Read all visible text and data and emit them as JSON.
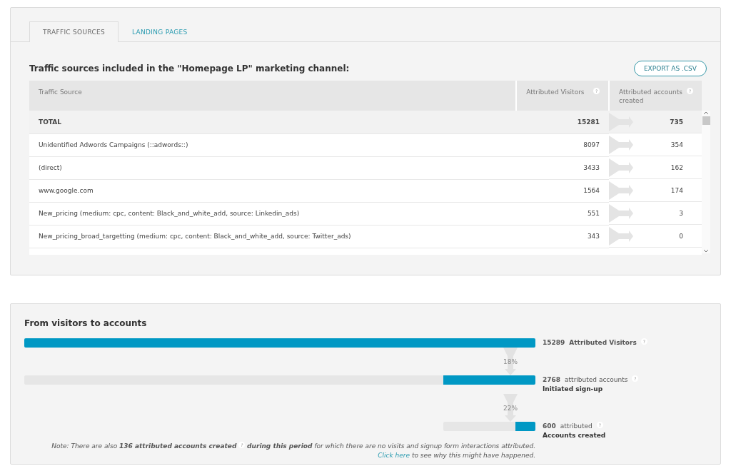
{
  "tabs": [
    {
      "label": "TRAFFIC SOURCES",
      "selected": true
    },
    {
      "label": "LANDING PAGES",
      "selected": false
    }
  ],
  "table_title": "Traffic sources included in the \"Homepage LP\" marketing channel:",
  "export_button": "EXPORT AS .CSV",
  "table": {
    "columns": [
      {
        "label": "Traffic Source"
      },
      {
        "label": "Attributed Visitors",
        "help": "?"
      },
      {
        "label": "Attributed accounts created",
        "help": "?"
      }
    ],
    "rows": [
      {
        "kind": "total",
        "source": "TOTAL",
        "visitors": "15281",
        "accounts": "735"
      },
      {
        "kind": "row",
        "source": "Unidentified Adwords Campaigns (::adwords::)",
        "visitors": "8097",
        "accounts": "354"
      },
      {
        "kind": "row",
        "source": "(direct)",
        "visitors": "3433",
        "accounts": "162"
      },
      {
        "kind": "row",
        "source": "www.google.com",
        "visitors": "1564",
        "accounts": "174"
      },
      {
        "kind": "row",
        "source": "New_pricing (medium: cpc, content: Black_and_white_add, source: Linkedin_ads)",
        "visitors": "551",
        "accounts": "3"
      },
      {
        "kind": "row",
        "source": "New_pricing_broad_targetting (medium: cpc, content: Black_and_white_add, source: Twitter_ads)",
        "visitors": "343",
        "accounts": "0"
      }
    ]
  },
  "funnel": {
    "title": "From visitors to accounts",
    "stages": [
      {
        "count": "15289",
        "label": "Attributed Visitors",
        "help": "?",
        "level": 1
      },
      {
        "rate": "18%",
        "count": "2768",
        "label": "attributed accounts",
        "help": "?",
        "sublabel": "Initiated sign-up",
        "level": 0.18
      },
      {
        "rate": "22%",
        "count": "600",
        "label": "attributed",
        "help": "?",
        "sublabel": "Accounts created",
        "level": 0.22
      }
    ],
    "note_help": "?",
    "note_start": "Note: There are also **136 attributed accounts created**",
    "note_end": "**during this period** for which there are no visits and signup form interactions attributed.",
    "link": "Click here",
    "link_tail": "to see why this might have happened."
  }
}
